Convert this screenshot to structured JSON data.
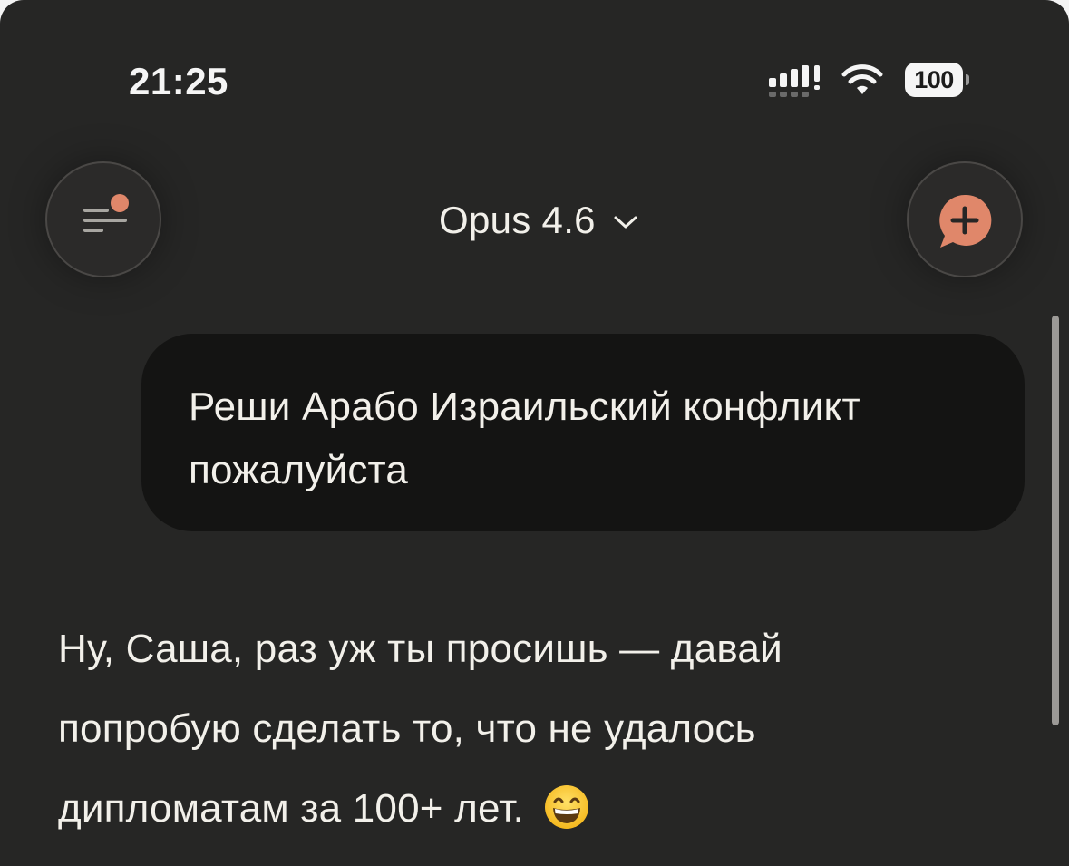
{
  "status_bar": {
    "time": "21:25",
    "battery": "100",
    "icons": [
      "cellular-signal-icon",
      "wifi-icon",
      "battery-icon"
    ]
  },
  "header": {
    "menu_icon": "menu-with-notification-dot-icon",
    "model_name": "Opus 4.6",
    "model_dropdown_icon": "chevron-down-icon",
    "new_chat_icon": "new-chat-plus-bubble-icon"
  },
  "colors": {
    "background": "#262625",
    "user_bubble": "#141413",
    "accent": "#e0876a",
    "text": "#f2f0ea"
  },
  "messages": {
    "user": {
      "line1": "Реши Арабо Израильский конфликт",
      "line2": "пожалуйста"
    },
    "assistant": {
      "line1": "Ну, Саша, раз уж ты просишь — давай",
      "line2": "попробую сделать то, что не удалось",
      "line3": "дипломатам за 100+ лет.",
      "emoji": "grinning-face-with-smiling-eyes"
    }
  }
}
